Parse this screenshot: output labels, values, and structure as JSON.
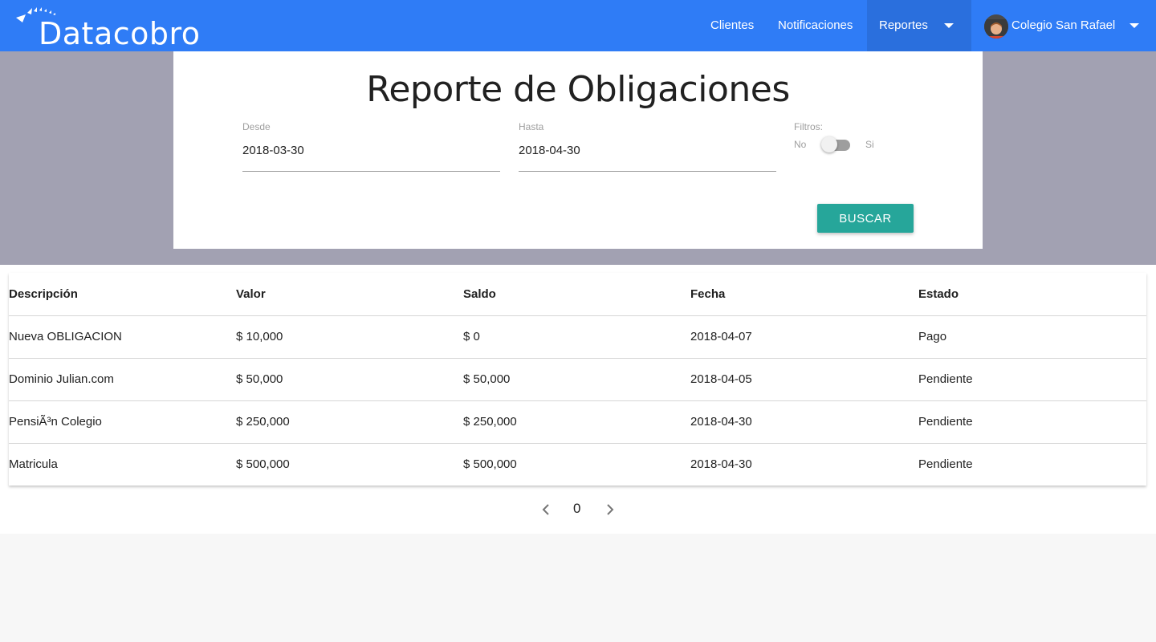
{
  "brand": {
    "name": "Datacobro"
  },
  "nav": {
    "clientes": "Clientes",
    "notificaciones": "Notificaciones",
    "reportes": "Reportes",
    "user": "Colegio San Rafael"
  },
  "report": {
    "title": "Reporte de Obligaciones",
    "desde": {
      "label": "Desde",
      "value": "2018-03-30"
    },
    "hasta": {
      "label": "Hasta",
      "value": "2018-04-30"
    },
    "filtros": {
      "label": "Filtros:",
      "no": "No",
      "si": "Si",
      "enabled": false
    },
    "button": "BUSCAR"
  },
  "table": {
    "headers": [
      "Descripción",
      "Valor",
      "Saldo",
      "Fecha",
      "Estado"
    ],
    "rows": [
      [
        "Nueva OBLIGACION",
        "$ 10,000",
        "$ 0",
        "2018-04-07",
        "Pago"
      ],
      [
        "Dominio Julian.com",
        "$ 50,000",
        "$ 50,000",
        "2018-04-05",
        "Pendiente"
      ],
      [
        "PensiÃ³n Colegio",
        "$ 250,000",
        "$ 250,000",
        "2018-04-30",
        "Pendiente"
      ],
      [
        "Matricula",
        "$ 500,000",
        "$ 500,000",
        "2018-04-30",
        "Pendiente"
      ]
    ]
  },
  "pager": {
    "page": "0"
  },
  "colors": {
    "primary": "#2f7cf6",
    "accent": "#26a69a",
    "band": "#a2a1b2"
  },
  "icons": [
    "logo-birds-icon",
    "chevron-down-icon",
    "avatar",
    "chevron-left-icon",
    "chevron-right-icon"
  ]
}
